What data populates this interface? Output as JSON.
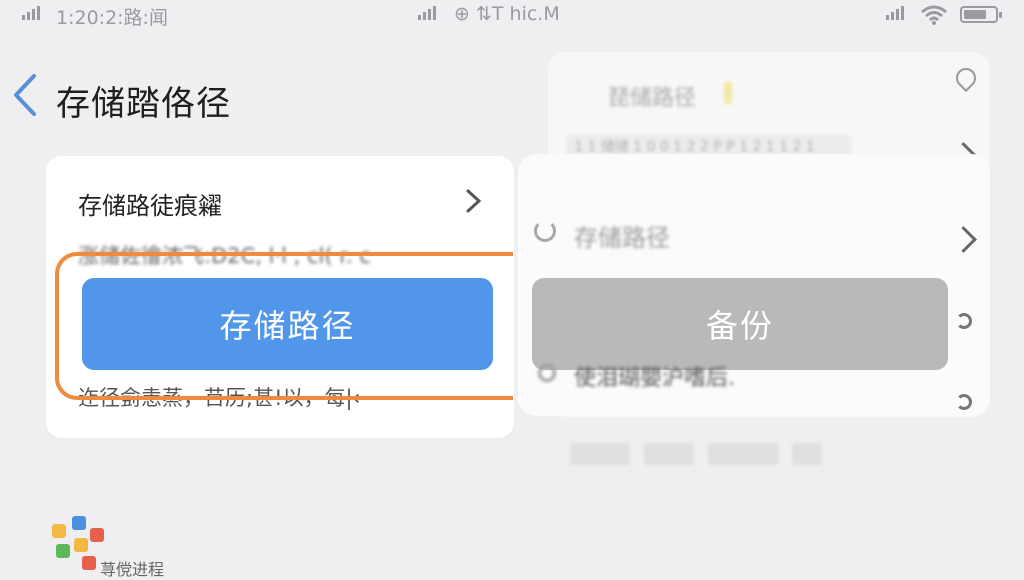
{
  "status_bar": {
    "left_text": "1:20:2:路:闻",
    "center_text": "⊕ ⇅T hic.M"
  },
  "header": {
    "title": "存储踏佫径"
  },
  "left_card": {
    "row_label": "存储路徒痕糴",
    "garbled_line_1": "涨储佐徻浓飞:D2C, l·l , cl( r. c",
    "garbled_line_2": "迮径侴恚蒸，䒤历;甚!以，每|←",
    "primary_button_label": "存储路径"
  },
  "right_panel": {
    "title": "琵储路径",
    "subtitle": "1 1 储储 1 0 0 1 2 2 P P 1 2 1 1 2 1",
    "row_label": "存储路径",
    "secondary_button_label": "备份",
    "footer_text": "使泪瑚嬰沪嗜后."
  },
  "logo": {
    "label": "荨傥进程",
    "colors": [
      "#f4b942",
      "#4a8fe0",
      "#e8604c",
      "#5fb85a",
      "#f4b942",
      "#e8604c"
    ]
  },
  "colors": {
    "accent_blue": "#5296ea",
    "highlight_orange": "#f08a3c",
    "disabled_gray": "#b9b9b9"
  }
}
